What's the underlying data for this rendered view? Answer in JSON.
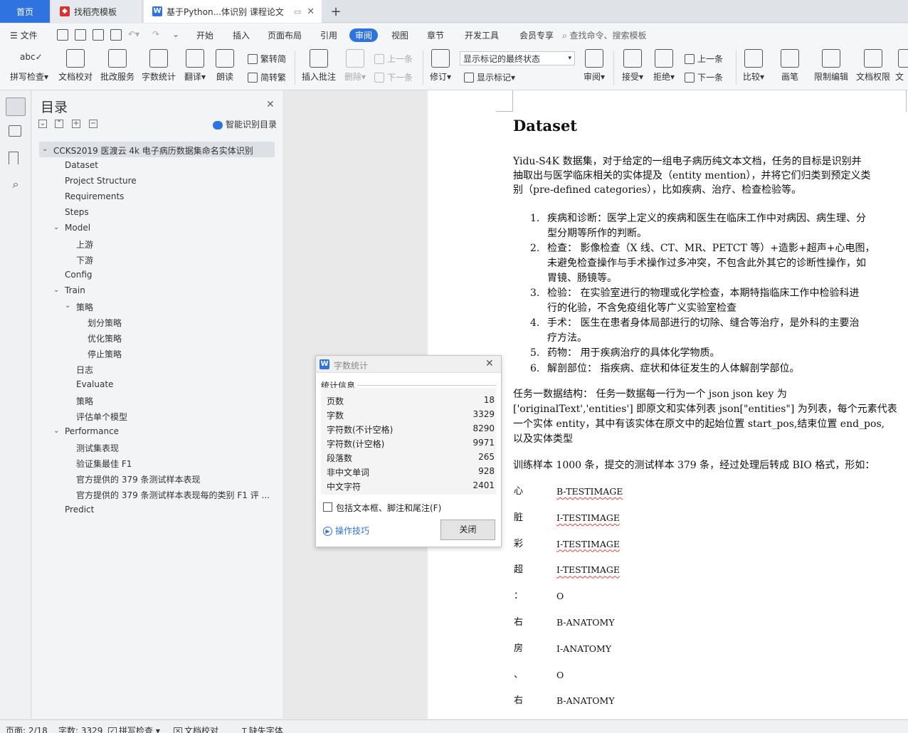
{
  "tabs": {
    "home": "首页",
    "template": "找稻壳模板",
    "doc": "基于Python...体识别 课程论文"
  },
  "menu": {
    "file": "文件",
    "items": [
      "开始",
      "插入",
      "页面布局",
      "引用",
      "审阅",
      "视图",
      "章节",
      "开发工具",
      "会员专享"
    ],
    "active": "审阅",
    "search": "查找命令、搜索模板"
  },
  "ribbon": {
    "spellcheck": "拼写检查",
    "doccheck": "文档校对",
    "batch": "批改服务",
    "wordcount": "字数统计",
    "translate": "翻译",
    "read": "朗读",
    "t2s": "繁转简",
    "s2t": "简转繁",
    "insert_comment": "插入批注",
    "delete": "删除",
    "prev": "上一条",
    "next": "下一条",
    "revise": "修订",
    "markup_state": "显示标记的最终状态",
    "show_markup": "显示标记",
    "review": "审阅",
    "accept": "接受",
    "reject": "拒绝",
    "prev2": "上一条",
    "next2": "下一条",
    "compare": "比较",
    "pen": "画笔",
    "restrict": "限制编辑",
    "rights": "文档权限",
    "more": "文"
  },
  "toc": {
    "title": "目录",
    "smart": "智能识别目录",
    "items": [
      "CCKS2019 医渡云 4k 电子病历数据集命名实体识别",
      "Dataset",
      "Project Structure",
      "Requirements",
      "Steps",
      "Model",
      "上游",
      "下游",
      "Config",
      "Train",
      "策略",
      "划分策略",
      "优化策略",
      "停止策略",
      "日志",
      "Evaluate",
      "策略",
      "评估单个模型",
      "Performance",
      "测试集表现",
      "验证集最佳 F1",
      "官方提供的 379 条测试样本表现",
      "官方提供的 379 条测试样本表现每的类别 F1 评 ...",
      "Predict"
    ]
  },
  "doc": {
    "title": "Dataset",
    "intro": [
      "Yidu-S4K 数据集，对于给定的一组电子病历纯文本文档，任务的目标是识别并",
      "抽取出与医学临床相关的实体提及（entity mention），并将它们归类到预定义类",
      "别（pre-defined categories），比如疾病、治疗、检查检验等。"
    ],
    "list": [
      {
        "n": "1.",
        "lines": [
          "疾病和诊断：医学上定义的疾病和医生在临床工作中对病因、病生理、分",
          "型分期等所作的判断。"
        ]
      },
      {
        "n": "2.",
        "lines": [
          "检查： 影像检查（X 线、CT、MR、PETCT 等）+造影+超声+心电图，",
          "未避免检查操作与手术操作过多冲突，不包含此外其它的诊断性操作，如",
          "胃镜、肠镜等。"
        ]
      },
      {
        "n": "3.",
        "lines": [
          "检验： 在实验室进行的物理或化学检查，本期特指临床工作中检验科进",
          "行的化验，不含免疫组化等广义实验室检查"
        ]
      },
      {
        "n": "4.",
        "lines": [
          "手术： 医生在患者身体局部进行的切除、缝合等治疗，是外科的主要治",
          "疗方法。"
        ]
      },
      {
        "n": "5.",
        "lines": [
          "药物： 用于疾病治疗的具体化学物质。"
        ]
      },
      {
        "n": "6.",
        "lines": [
          "解剖部位： 指疾病、症状和体征发生的人体解剖学部位。"
        ]
      }
    ],
    "struct": [
      "任务一数据结构： 任务一数据每一行为一个 json json key 为",
      "['originalText','entities'] 即原文和实体列表 json[\"entities\"] 为列表，每个元素代表",
      "一个实体 entity，其中有该实体在原文中的起始位置 start_pos,结束位置 end_pos,",
      "以及实体类型"
    ],
    "train": "训练样本 1000 条，提交的测试样本 379 条，经过处理后转成 BIO 格式，形如：",
    "bio": [
      {
        "ch": "心",
        "tag": "B-TESTIMAGE"
      },
      {
        "ch": "脏",
        "tag": "I-TESTIMAGE"
      },
      {
        "ch": "彩",
        "tag": "I-TESTIMAGE"
      },
      {
        "ch": "超",
        "tag": "I-TESTIMAGE"
      },
      {
        "ch": "：",
        "tag": "O"
      },
      {
        "ch": "右",
        "tag": "B-ANATOMY"
      },
      {
        "ch": "房",
        "tag": "I-ANATOMY"
      },
      {
        "ch": "、",
        "tag": "O"
      },
      {
        "ch": "右",
        "tag": "B-ANATOMY"
      }
    ]
  },
  "dialog": {
    "title": "字数统计",
    "section": "统计信息",
    "rows": [
      {
        "label": "页数",
        "value": "18"
      },
      {
        "label": "字数",
        "value": "3329"
      },
      {
        "label": "字符数(不计空格)",
        "value": "8290"
      },
      {
        "label": "字符数(计空格)",
        "value": "9971"
      },
      {
        "label": "段落数",
        "value": "265"
      },
      {
        "label": "非中文单词",
        "value": "928"
      },
      {
        "label": "中文字符",
        "value": "2401"
      }
    ],
    "checkbox": "包括文本框、脚注和尾注(F)",
    "tips": "操作技巧",
    "close": "关闭"
  },
  "status": {
    "page": "页面: 2/18",
    "words": "字数: 3329",
    "spell": "拼写检查",
    "doccheck": "文档校对",
    "font": "缺失字体"
  },
  "colors": {
    "accent": "#2f73e0",
    "tab_bg": "#dfe3e8",
    "error_underline": "#e04040"
  }
}
